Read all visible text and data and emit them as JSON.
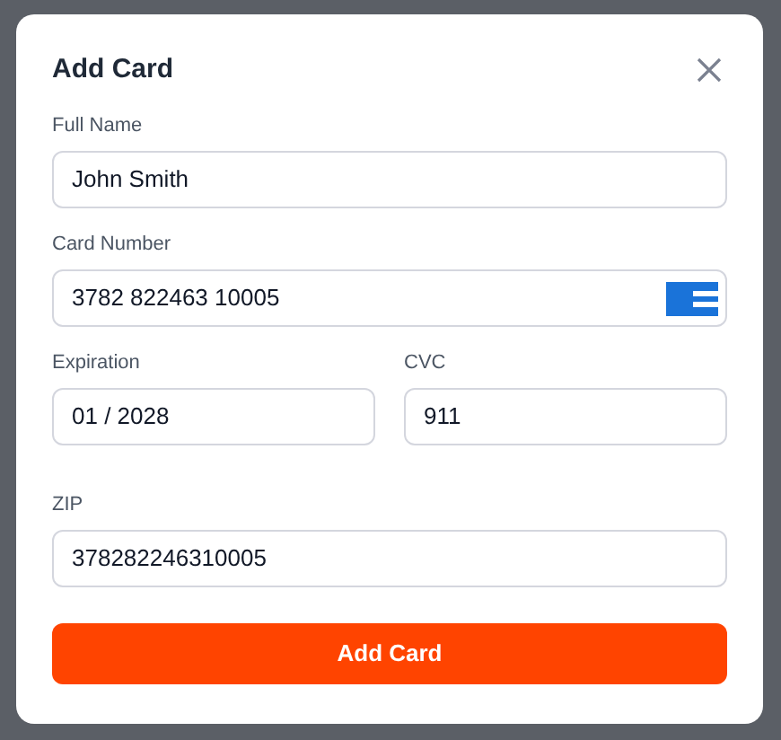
{
  "dialog": {
    "title": "Add Card"
  },
  "fields": [
    {
      "label": "Full Name",
      "value": "John Smith"
    },
    {
      "label": "Card Number",
      "value": "3782 822463 10005",
      "kind": "card"
    },
    {
      "label": "Expiration",
      "value": "01 / 2028",
      "kind": "half"
    },
    {
      "label": "CVC",
      "value": "911",
      "kind": "half"
    },
    {
      "label": "ZIP",
      "value": "378282246310005"
    }
  ],
  "submit": "Add Card"
}
